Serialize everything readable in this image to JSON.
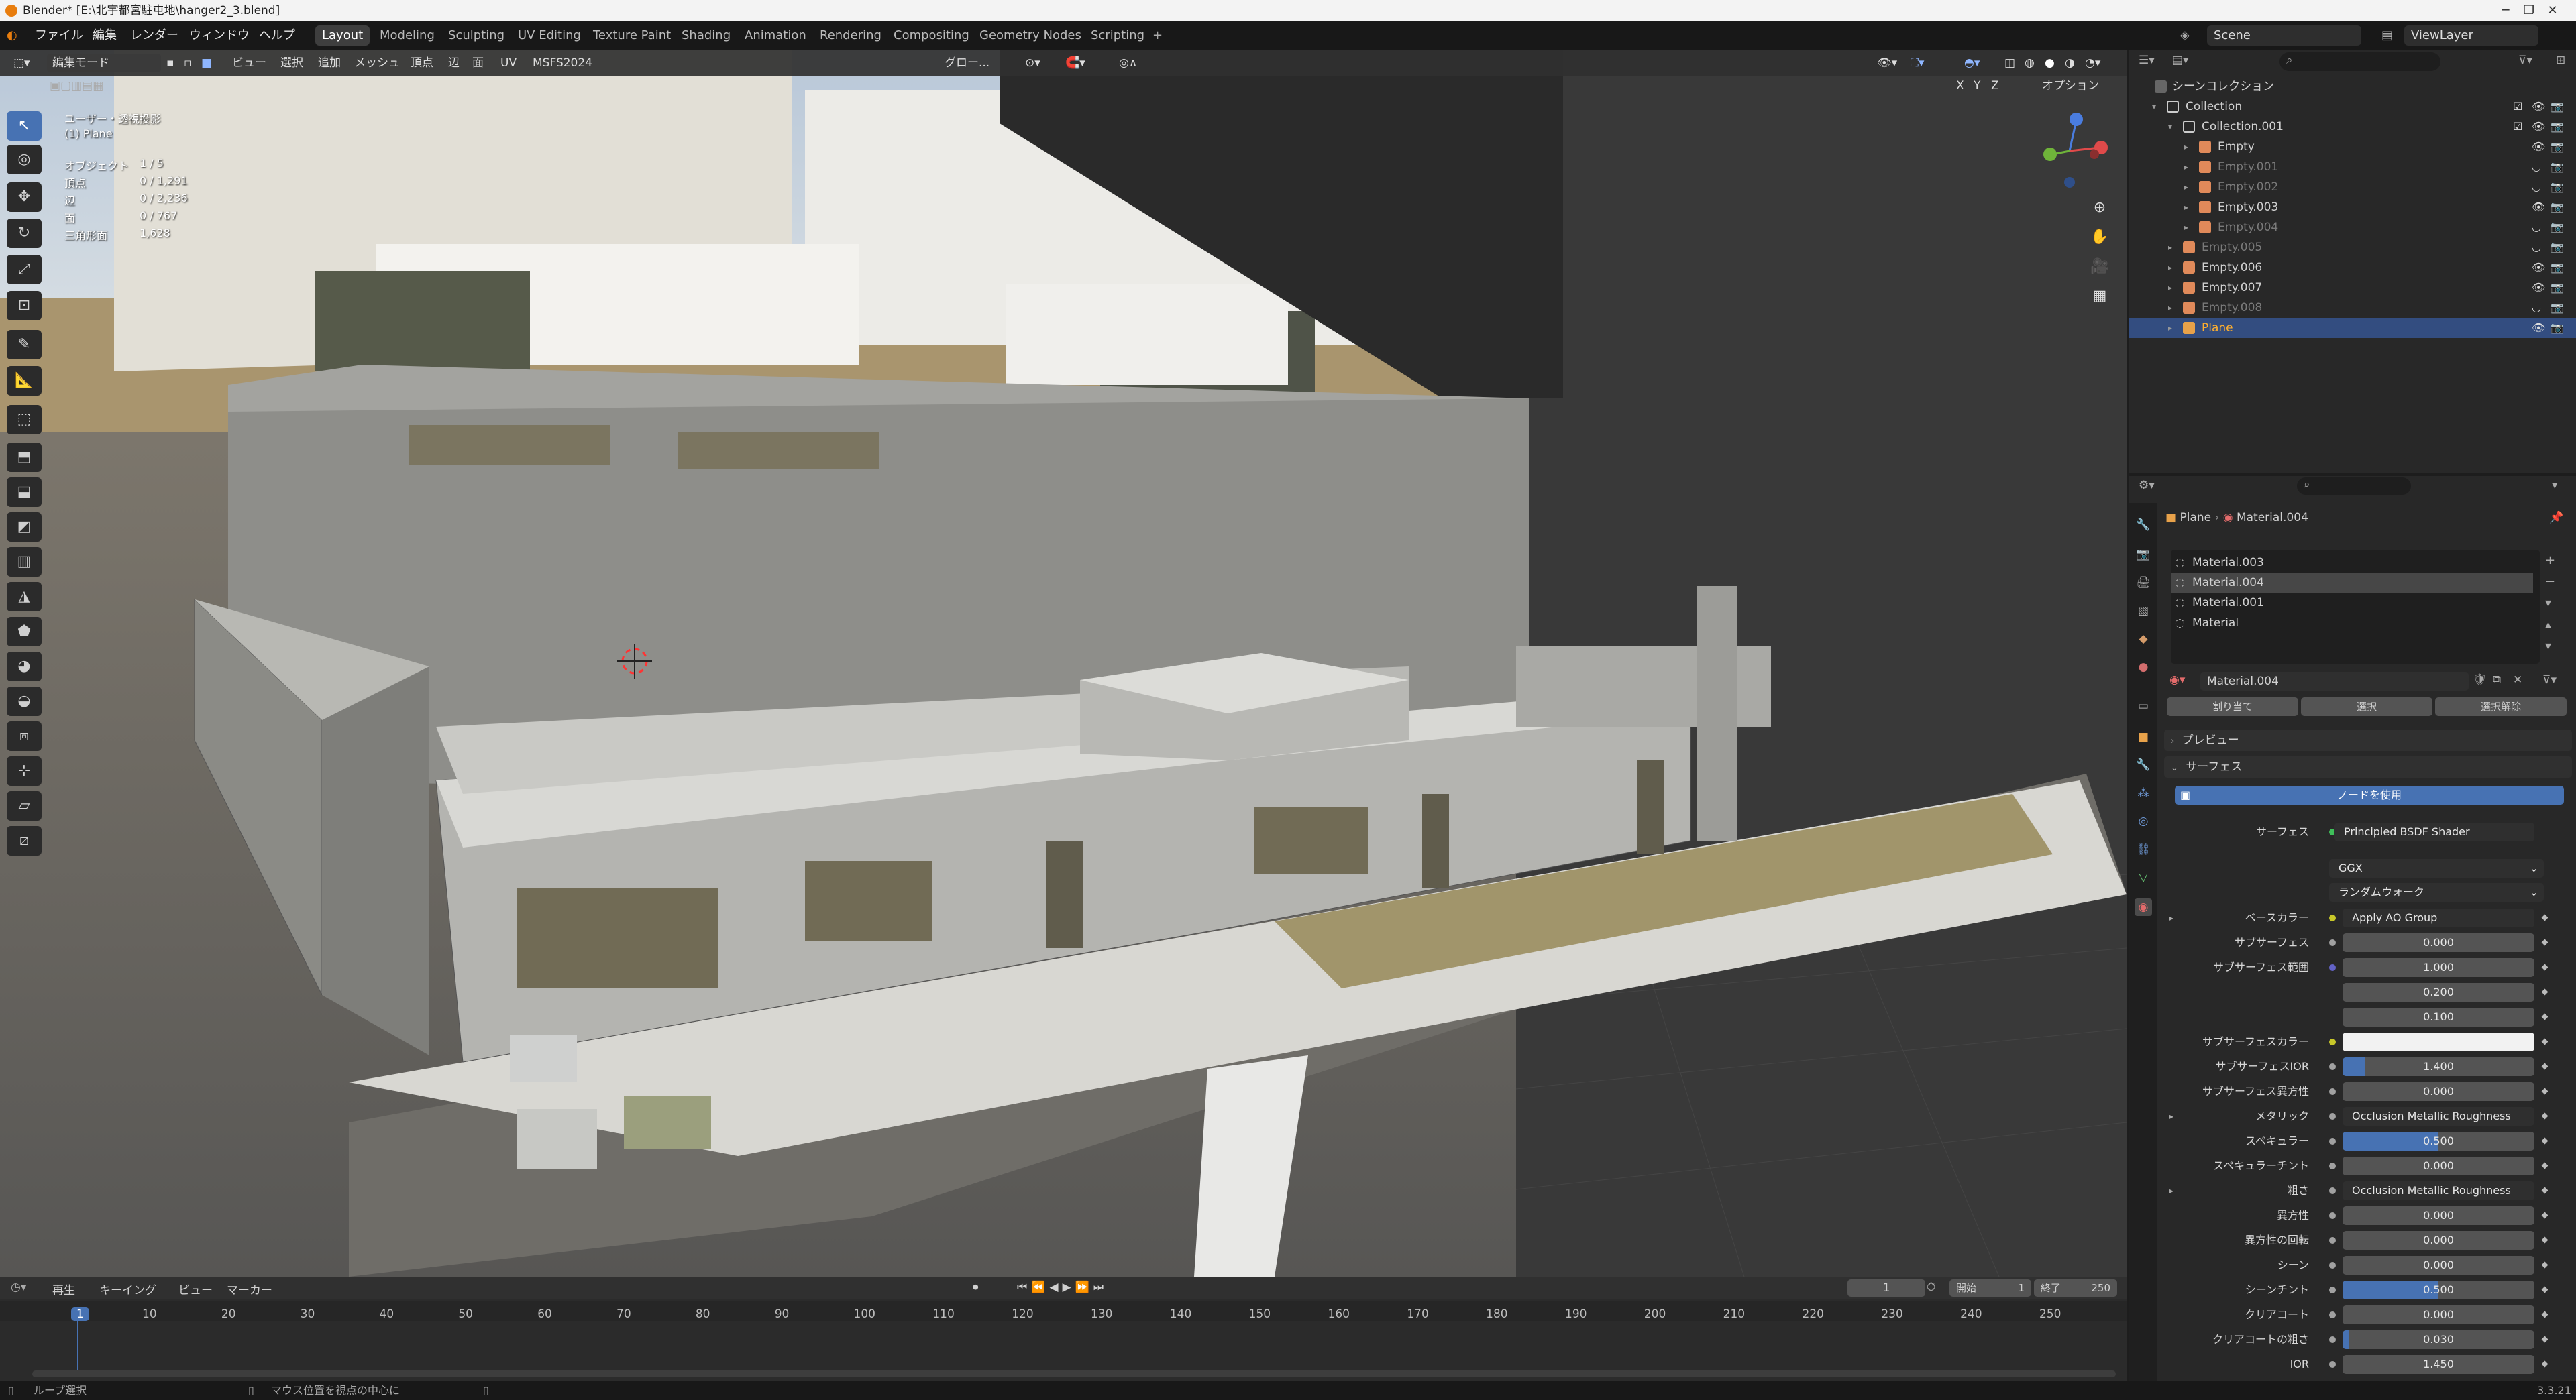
{
  "window": {
    "title": "Blender* [E:\\北宇都宮駐屯地\\hanger2_3.blend]"
  },
  "menu": [
    "ファイル",
    "編集",
    "レンダー",
    "ウィンドウ",
    "ヘルプ"
  ],
  "workspaces": [
    "Layout",
    "Modeling",
    "Sculpting",
    "UV Editing",
    "Texture Paint",
    "Shading",
    "Animation",
    "Rendering",
    "Compositing",
    "Geometry Nodes",
    "Scripting"
  ],
  "active_workspace": "Layout",
  "top_right": {
    "scene": "Scene",
    "view_layer": "ViewLayer"
  },
  "viewport_header": {
    "mode": "編集モード",
    "items": [
      "ビュー",
      "選択",
      "追加",
      "メッシュ",
      "頂点",
      "辺",
      "面",
      "UV",
      "MSFS2024"
    ],
    "orientation": "グロー...",
    "options": "オプション",
    "axes": [
      "X",
      "Y",
      "Z"
    ]
  },
  "overlay": {
    "view": "ユーザー・透視投影",
    "object": "(1) Plane",
    "stats": [
      {
        "label": "オブジェクト",
        "value": "1 / 5"
      },
      {
        "label": "頂点",
        "value": "0 / 1,291"
      },
      {
        "label": "辺",
        "value": "0 / 2,236"
      },
      {
        "label": "面",
        "value": "0 / 767"
      },
      {
        "label": "三角形面",
        "value": "1,628"
      }
    ]
  },
  "outliner": {
    "root": "シーンコレクション",
    "rows": [
      {
        "name": "Collection",
        "type": "collection"
      },
      {
        "name": "Collection.001",
        "type": "collection"
      },
      {
        "name": "Empty",
        "type": "empty"
      },
      {
        "name": "Empty.001",
        "type": "empty",
        "dim": true
      },
      {
        "name": "Empty.002",
        "type": "empty",
        "dim": true
      },
      {
        "name": "Empty.003",
        "type": "empty"
      },
      {
        "name": "Empty.004",
        "type": "empty",
        "dim": true
      },
      {
        "name": "Empty.005",
        "type": "empty",
        "dim": true
      },
      {
        "name": "Empty.006",
        "type": "empty"
      },
      {
        "name": "Empty.007",
        "type": "empty"
      },
      {
        "name": "Empty.008",
        "type": "empty",
        "dim": true
      },
      {
        "name": "Plane",
        "type": "mesh",
        "selected": true
      }
    ]
  },
  "properties": {
    "breadcrumb": [
      "Plane",
      "Material.004"
    ],
    "slots": [
      "Material.003",
      "Material.004",
      "Material.001",
      "Material"
    ],
    "active_slot": "Material.004",
    "material_name": "Material.004",
    "buttons": [
      "割り当て",
      "選択",
      "選択解除"
    ],
    "panels": {
      "preview": "プレビュー",
      "surface": "サーフェス"
    },
    "use_nodes": "ノードを使用",
    "surface_label": "サーフェス",
    "shader": "Principled BSDF Shader",
    "distribution": "GGX",
    "subsurface_method": "ランダムウォーク",
    "rows": [
      {
        "label": "ベースカラー",
        "value": "Apply AO Group",
        "kind": "link",
        "dot": "#c7c729",
        "expand": true
      },
      {
        "label": "サブサーフェス",
        "value": "0.000",
        "kind": "num",
        "dot": "#a1a1a1",
        "fill": 0
      },
      {
        "label": "サブサーフェス範囲",
        "value": "1.000",
        "kind": "num",
        "dot": "#6363c7",
        "fill": 0
      },
      {
        "label": "",
        "value": "0.200",
        "kind": "num",
        "fill": 0
      },
      {
        "label": "",
        "value": "0.100",
        "kind": "num",
        "fill": 0
      },
      {
        "label": "サブサーフェスカラー",
        "value": "",
        "kind": "color",
        "dot": "#c7c729"
      },
      {
        "label": "サブサーフェスIOR",
        "value": "1.400",
        "kind": "num",
        "dot": "#a1a1a1",
        "fill": 0.12
      },
      {
        "label": "サブサーフェス異方性",
        "value": "0.000",
        "kind": "num",
        "dot": "#a1a1a1",
        "fill": 0
      },
      {
        "label": "メタリック",
        "value": "Occlusion Metallic Roughness Group",
        "kind": "link",
        "dot": "#a1a1a1",
        "expand": true
      },
      {
        "label": "スペキュラー",
        "value": "0.500",
        "kind": "num",
        "dot": "#a1a1a1",
        "fill": 0.5
      },
      {
        "label": "スペキュラーチント",
        "value": "0.000",
        "kind": "num",
        "dot": "#a1a1a1",
        "fill": 0
      },
      {
        "label": "粗さ",
        "value": "Occlusion Metallic Roughness Group",
        "kind": "link",
        "dot": "#a1a1a1",
        "expand": true
      },
      {
        "label": "異方性",
        "value": "0.000",
        "kind": "num",
        "dot": "#a1a1a1",
        "fill": 0
      },
      {
        "label": "異方性の回転",
        "value": "0.000",
        "kind": "num",
        "dot": "#a1a1a1",
        "fill": 0
      },
      {
        "label": "シーン",
        "value": "0.000",
        "kind": "num",
        "dot": "#a1a1a1",
        "fill": 0
      },
      {
        "label": "シーンチント",
        "value": "0.500",
        "kind": "num",
        "dot": "#a1a1a1",
        "fill": 0.5
      },
      {
        "label": "クリアコート",
        "value": "0.000",
        "kind": "num",
        "dot": "#a1a1a1",
        "fill": 0
      },
      {
        "label": "クリアコートの粗さ",
        "value": "0.030",
        "kind": "num",
        "dot": "#a1a1a1",
        "fill": 0.03
      },
      {
        "label": "IOR",
        "value": "1.450",
        "kind": "num",
        "dot": "#a1a1a1",
        "fill": 0
      }
    ]
  },
  "timeline": {
    "menu": [
      "再生",
      "キーイング",
      "ビュー",
      "マーカー"
    ],
    "current_frame": "1",
    "start_label": "開始",
    "start": "1",
    "end_label": "終了",
    "end": "250",
    "ticks": [
      "1",
      "10",
      "20",
      "30",
      "40",
      "50",
      "60",
      "70",
      "80",
      "90",
      "100",
      "110",
      "120",
      "130",
      "140",
      "150",
      "160",
      "170",
      "180",
      "190",
      "200",
      "210",
      "220",
      "230",
      "240",
      "250"
    ]
  },
  "status": {
    "left": "ループ選択",
    "middle": "マウス位置を視点の中心に",
    "version": "3.3.21"
  }
}
